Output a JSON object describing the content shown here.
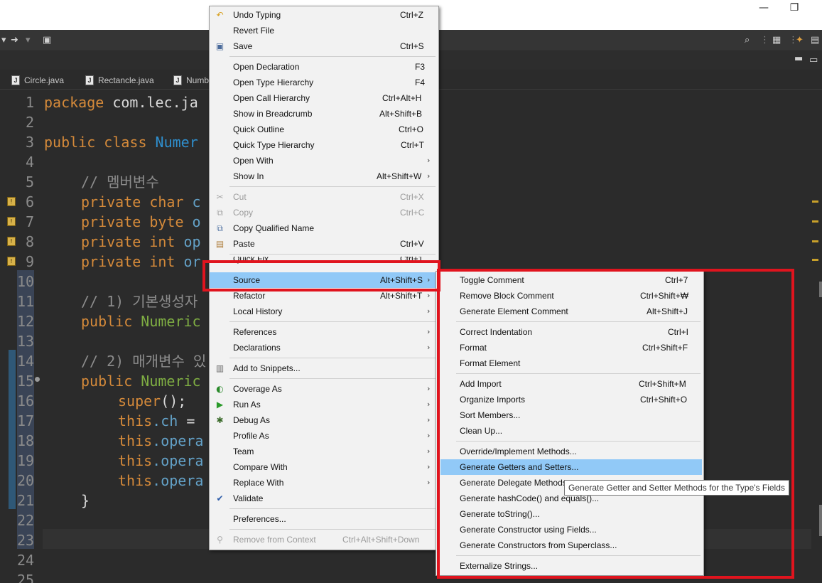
{
  "window": {
    "minimize_glyph": "—",
    "restore_glyph": "❐"
  },
  "tabs": [
    {
      "label": "Circle.java"
    },
    {
      "label": "Rectancle.java"
    },
    {
      "label": "Numb"
    }
  ],
  "editor": {
    "line_numbers": [
      "1",
      "2",
      "3",
      "4",
      "5",
      "6",
      "7",
      "8",
      "9",
      "10",
      "11",
      "12",
      "13",
      "14",
      "15",
      "16",
      "17",
      "18",
      "19",
      "20",
      "21",
      "22",
      "23",
      "24",
      "25"
    ],
    "code": {
      "l1_kw": "package",
      "l1_rest": " com.lec.ja",
      "l3_kw": "public class",
      "l3_cls": " Numer",
      "l5": "// 멤버변수",
      "l6_kw": "private char",
      "l6_fld": " c",
      "l7_kw": "private byte",
      "l7_fld": " o",
      "l8_kw": "private int",
      "l8_fld": " op",
      "l9_kw": "private int",
      "l9_fld": " or",
      "l11": "// 1) 기본생성자",
      "l12_kw": "public",
      "l12_fn": " Numeric",
      "l14": "// 2) 매개변수 있",
      "l15_kw": "public",
      "l15_fn": " Numeric",
      "l16_kw": "super",
      "l16_rest": "();",
      "l17_kw": "this",
      "l17_fld": ".ch",
      "l17_rest": " =",
      "l18_kw": "this",
      "l18_fld": ".opera",
      "l19_kw": "this",
      "l19_fld": ".opera",
      "l20_kw": "this",
      "l20_fld": ".opera",
      "l21": "}"
    }
  },
  "context_menu": {
    "items": [
      {
        "label": "Undo Typing",
        "shortcut": "Ctrl+Z",
        "icon": "undo-icon"
      },
      {
        "label": "Revert File",
        "shortcut": ""
      },
      {
        "label": "Save",
        "shortcut": "Ctrl+S",
        "icon": "save-icon"
      },
      {
        "label": "Open Declaration",
        "shortcut": "F3"
      },
      {
        "label": "Open Type Hierarchy",
        "shortcut": "F4"
      },
      {
        "label": "Open Call Hierarchy",
        "shortcut": "Ctrl+Alt+H"
      },
      {
        "label": "Show in Breadcrumb",
        "shortcut": "Alt+Shift+B"
      },
      {
        "label": "Quick Outline",
        "shortcut": "Ctrl+O"
      },
      {
        "label": "Quick Type Hierarchy",
        "shortcut": "Ctrl+T"
      },
      {
        "label": "Open With",
        "shortcut": ""
      },
      {
        "label": "Show In",
        "shortcut": "Alt+Shift+W"
      },
      {
        "label": "Cut",
        "shortcut": "Ctrl+X",
        "icon": "cut-icon"
      },
      {
        "label": "Copy",
        "shortcut": "Ctrl+C",
        "icon": "copy-icon"
      },
      {
        "label": "Copy Qualified Name",
        "shortcut": "",
        "icon": "copy-qualified-icon"
      },
      {
        "label": "Paste",
        "shortcut": "Ctrl+V",
        "icon": "paste-icon"
      },
      {
        "label": "Quick Fix",
        "shortcut": "Ctrl+1"
      },
      {
        "label": "Source",
        "shortcut": "Alt+Shift+S"
      },
      {
        "label": "Refactor",
        "shortcut": "Alt+Shift+T"
      },
      {
        "label": "Local History",
        "shortcut": ""
      },
      {
        "label": "References",
        "shortcut": ""
      },
      {
        "label": "Declarations",
        "shortcut": ""
      },
      {
        "label": "Add to Snippets...",
        "shortcut": "",
        "icon": "snippet-icon"
      },
      {
        "label": "Coverage As",
        "shortcut": "",
        "icon": "coverage-icon"
      },
      {
        "label": "Run As",
        "shortcut": "",
        "icon": "run-icon"
      },
      {
        "label": "Debug As",
        "shortcut": "",
        "icon": "debug-icon"
      },
      {
        "label": "Profile As",
        "shortcut": ""
      },
      {
        "label": "Team",
        "shortcut": ""
      },
      {
        "label": "Compare With",
        "shortcut": ""
      },
      {
        "label": "Replace With",
        "shortcut": ""
      },
      {
        "label": "Validate",
        "shortcut": "",
        "icon": "check-icon"
      },
      {
        "label": "Preferences...",
        "shortcut": ""
      },
      {
        "label": "Remove from Context",
        "shortcut": "Ctrl+Alt+Shift+Down",
        "icon": "remove-context-icon"
      }
    ]
  },
  "source_submenu": {
    "items": [
      {
        "label": "Toggle Comment",
        "shortcut": "Ctrl+7"
      },
      {
        "label": "Remove Block Comment",
        "shortcut": "Ctrl+Shift+₩"
      },
      {
        "label": "Generate Element Comment",
        "shortcut": "Alt+Shift+J"
      },
      {
        "label": "Correct Indentation",
        "shortcut": "Ctrl+I"
      },
      {
        "label": "Format",
        "shortcut": "Ctrl+Shift+F"
      },
      {
        "label": "Format Element",
        "shortcut": ""
      },
      {
        "label": "Add Import",
        "shortcut": "Ctrl+Shift+M"
      },
      {
        "label": "Organize Imports",
        "shortcut": "Ctrl+Shift+O"
      },
      {
        "label": "Sort Members...",
        "shortcut": ""
      },
      {
        "label": "Clean Up...",
        "shortcut": ""
      },
      {
        "label": "Override/Implement Methods...",
        "shortcut": ""
      },
      {
        "label": "Generate Getters and Setters...",
        "shortcut": ""
      },
      {
        "label": "Generate Delegate Methods...",
        "shortcut": ""
      },
      {
        "label": "Generate hashCode() and equals()...",
        "shortcut": ""
      },
      {
        "label": "Generate toString()...",
        "shortcut": ""
      },
      {
        "label": "Generate Constructor using Fields...",
        "shortcut": ""
      },
      {
        "label": "Generate Constructors from Superclass...",
        "shortcut": ""
      },
      {
        "label": "Externalize Strings...",
        "shortcut": ""
      }
    ]
  },
  "tooltip": {
    "text": "Generate Getter and Setter Methods for the Type's Fields"
  },
  "colors": {
    "highlight": "#91c9f7",
    "annotation": "#e0141e",
    "keyword": "#d58a3a"
  }
}
